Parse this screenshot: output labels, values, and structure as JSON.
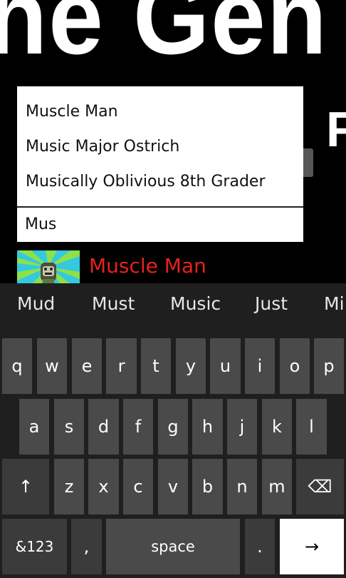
{
  "banner": {
    "text": "he Gen"
  },
  "background": {
    "partial_title": "F"
  },
  "suggestions": [
    "Muscle Man",
    "Music Major Ostrich",
    "Musically Oblivious 8th Grader"
  ],
  "search": {
    "value": "Mus"
  },
  "result": {
    "title": "Muscle Man"
  },
  "keyboard": {
    "word_suggestions": [
      "Mud",
      "Must",
      "Music",
      "Just",
      "Mi"
    ],
    "row1": [
      "q",
      "w",
      "e",
      "r",
      "t",
      "y",
      "u",
      "i",
      "o",
      "p"
    ],
    "row2": [
      "a",
      "s",
      "d",
      "f",
      "g",
      "h",
      "j",
      "k",
      "l"
    ],
    "row3": [
      "z",
      "x",
      "c",
      "v",
      "b",
      "n",
      "m"
    ],
    "shift": "↑",
    "backspace": "⌫",
    "numbers": "&123",
    "comma": ",",
    "space": "space",
    "period": ".",
    "enter": "→"
  },
  "colors": {
    "result_title": "#e5231b",
    "thumb_bg": "#33c9de",
    "thumb_ray": "#8ee04a"
  }
}
